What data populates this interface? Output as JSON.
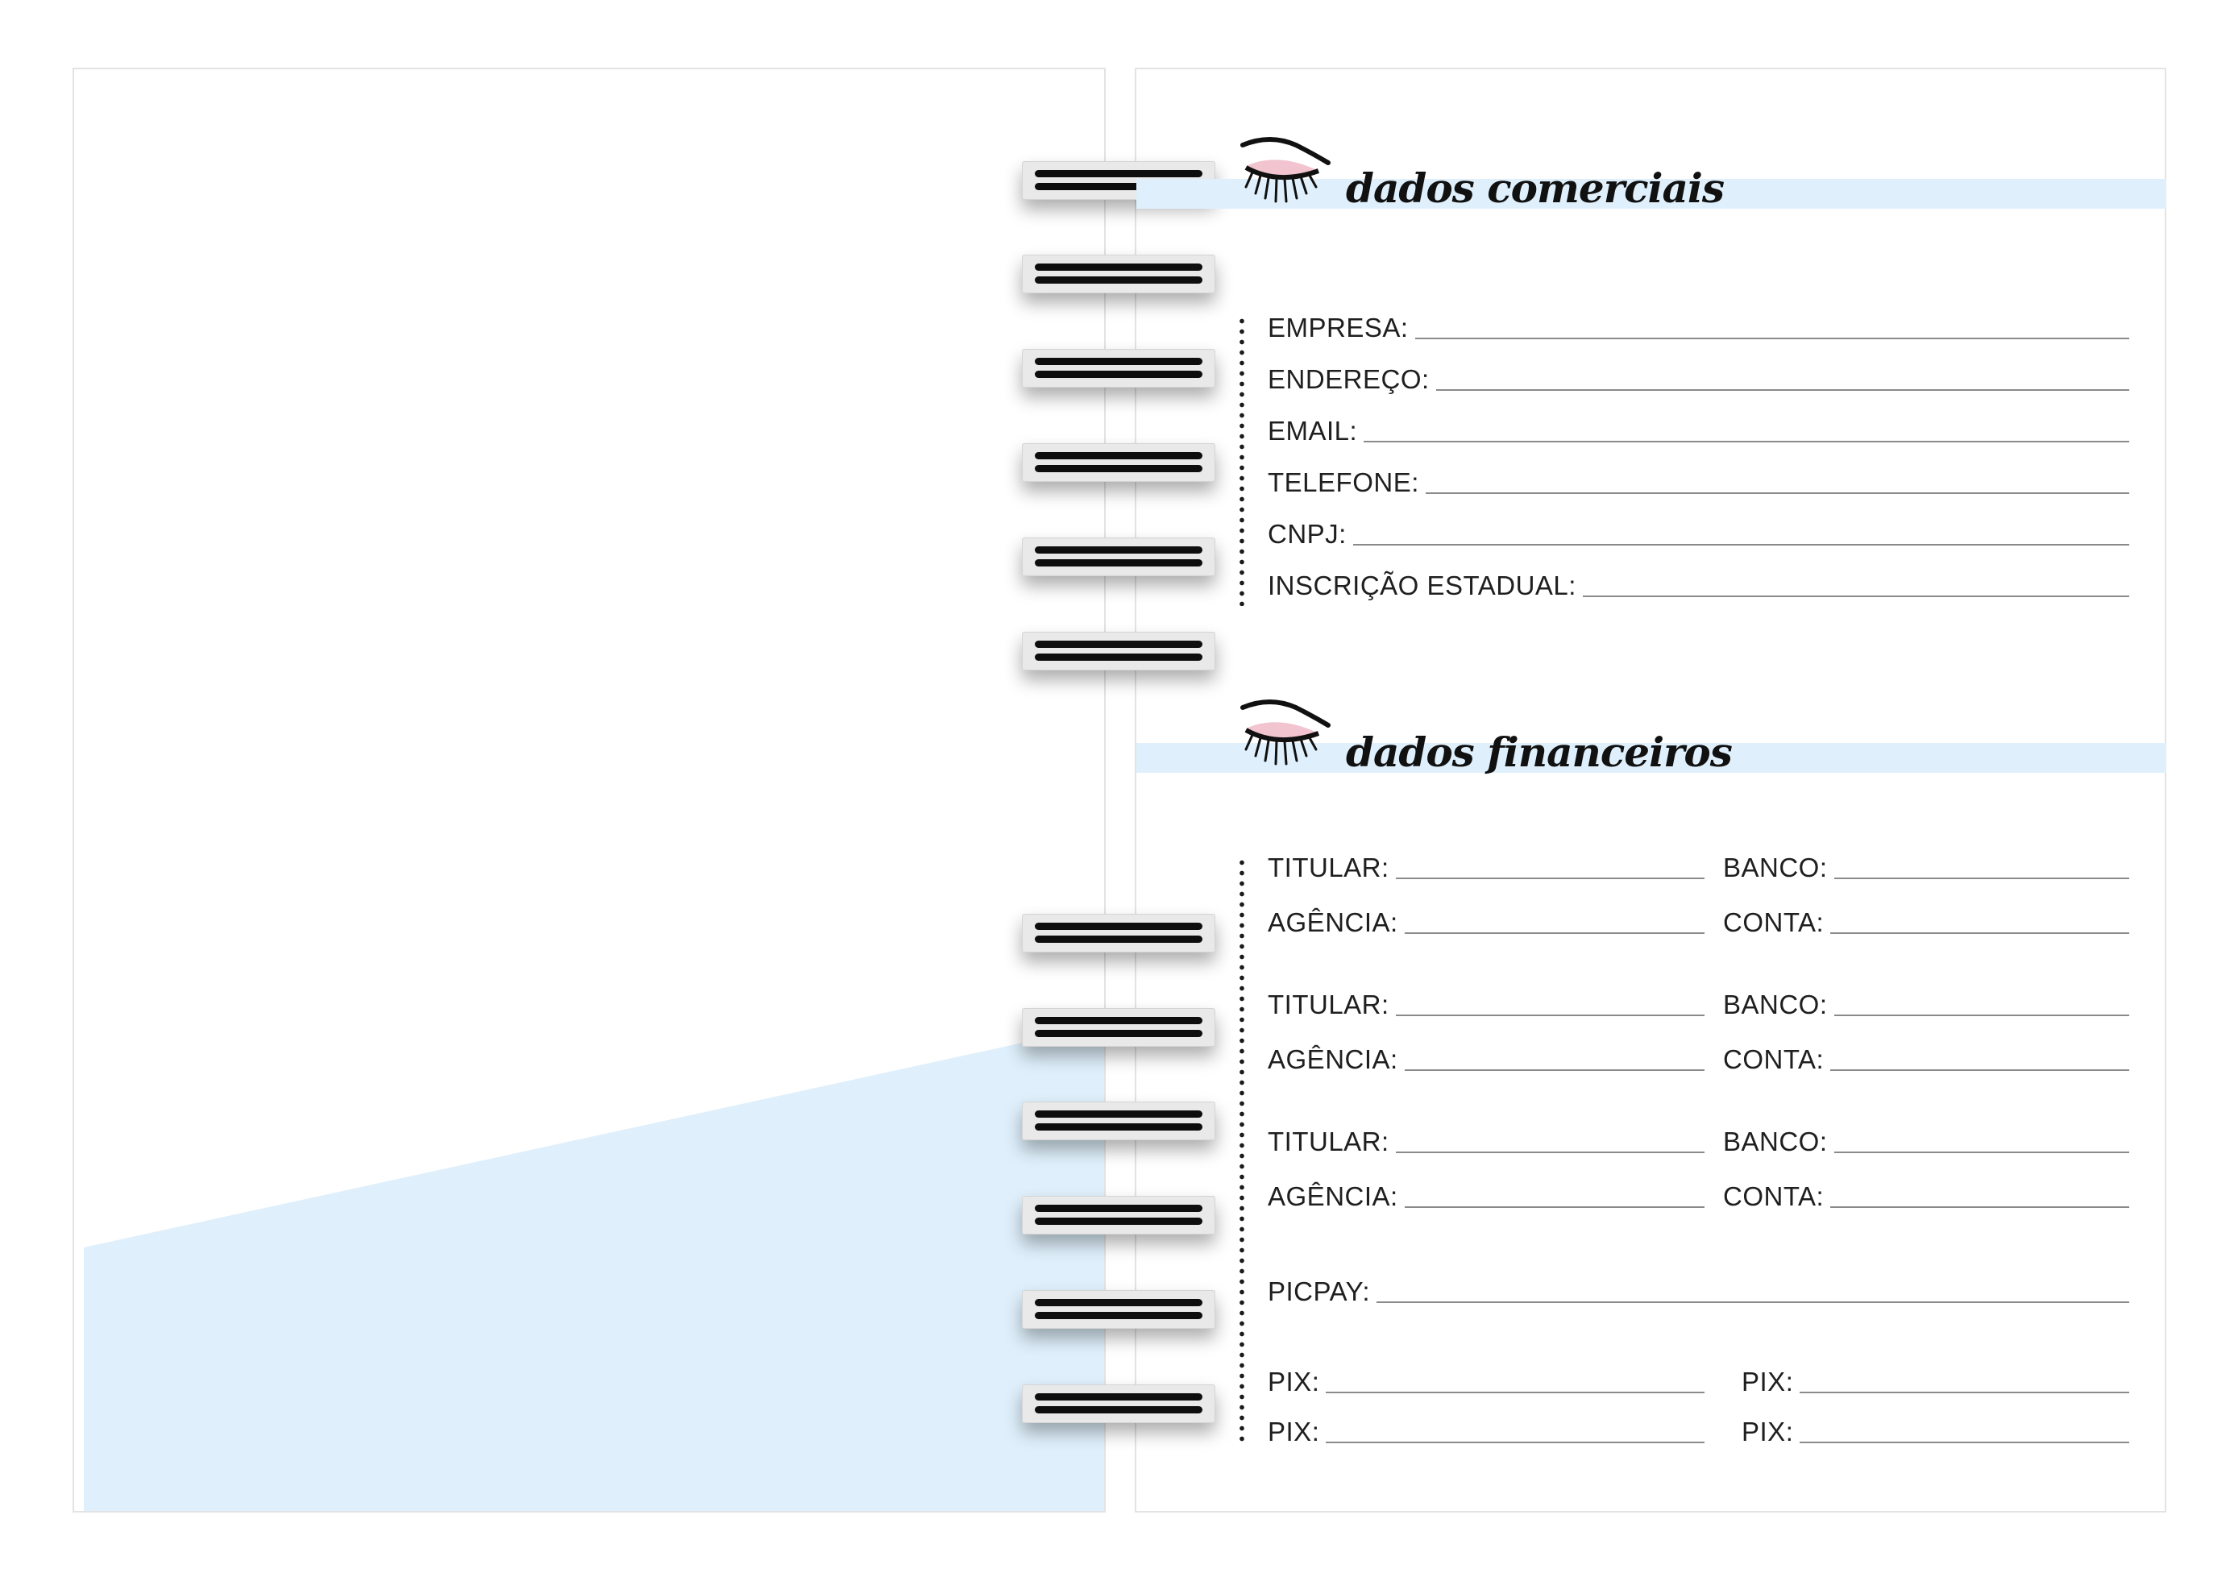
{
  "sections": {
    "commercial": {
      "title": "dados comerciais",
      "fields": {
        "empresa": "EMPRESA:",
        "endereco": "ENDEREÇO:",
        "email": "EMAIL:",
        "telefone": "TELEFONE:",
        "cnpj": "CNPJ:",
        "inscricao": "INSCRIÇÃO ESTADUAL:"
      }
    },
    "financial": {
      "title": "dados financeiros",
      "accounts": [
        {
          "titular": "TITULAR:",
          "banco": "BANCO:",
          "agencia": "AGÊNCIA:",
          "conta": "CONTA:"
        },
        {
          "titular": "TITULAR:",
          "banco": "BANCO:",
          "agencia": "AGÊNCIA:",
          "conta": "CONTA:"
        },
        {
          "titular": "TITULAR:",
          "banco": "BANCO:",
          "agencia": "AGÊNCIA:",
          "conta": "CONTA:"
        }
      ],
      "picpay": "PICPAY:",
      "pix": [
        "PIX:",
        "PIX:",
        "PIX:",
        "PIX:"
      ]
    }
  },
  "colors": {
    "accent_blue": "#dff0fc",
    "ring_bar": "#0e0e0e",
    "eyeshadow_pink": "#f2c4cf"
  },
  "icons": {
    "header_icon": "eye-lashes-icon",
    "binding": "spiral-ring-icon"
  }
}
